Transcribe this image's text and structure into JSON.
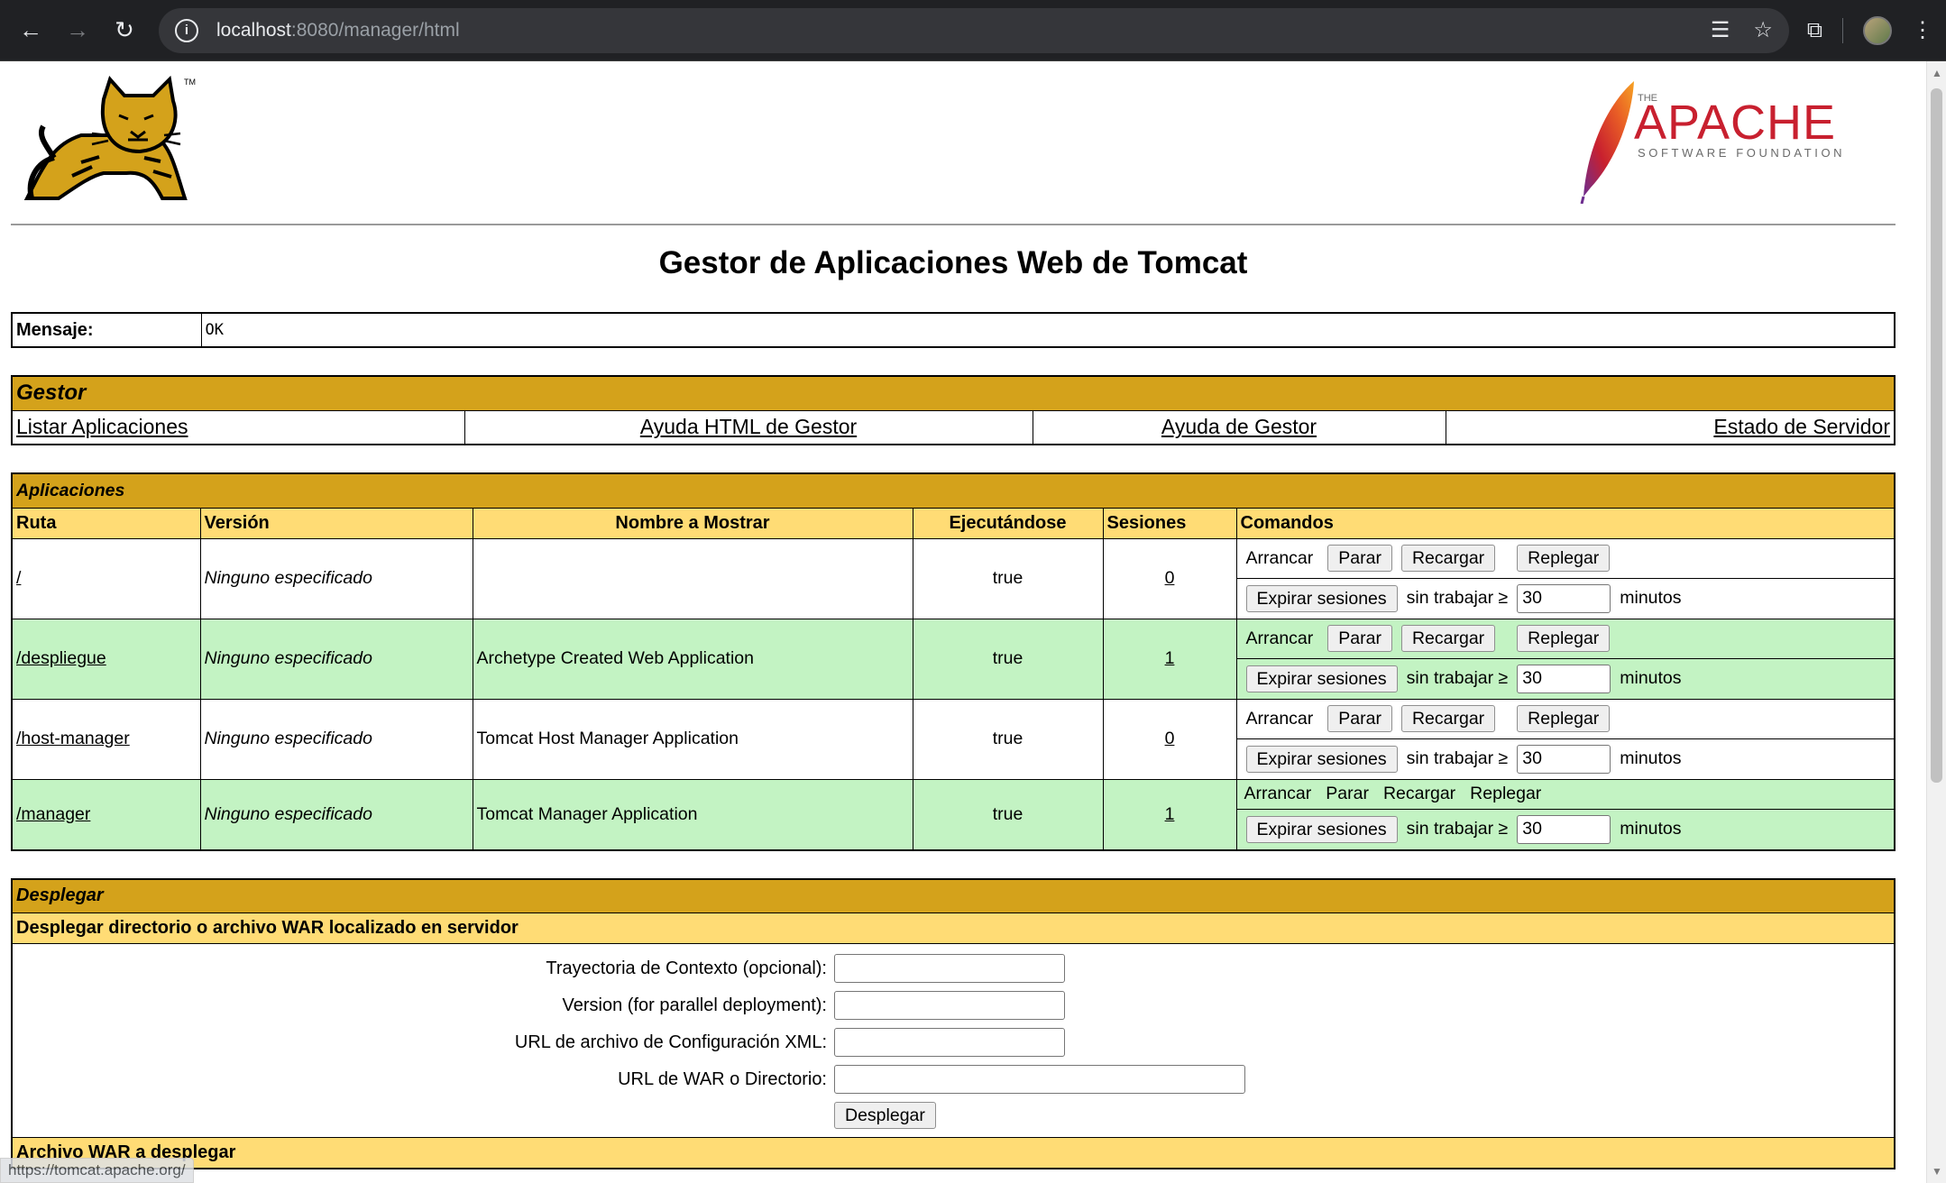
{
  "browser": {
    "url_host": "localhost",
    "url_rest": ":8080/manager/html",
    "icons": [
      "back-icon",
      "forward-icon",
      "reload-icon",
      "site-info-icon",
      "translate-icon",
      "star-icon",
      "extensions-icon",
      "avatar",
      "menu-icon"
    ]
  },
  "header": {
    "title": "Gestor de Aplicaciones Web de Tomcat",
    "apache_the": "THE",
    "apache_name": "APACHE",
    "apache_sub": "SOFTWARE FOUNDATION",
    "tomcat_tm": "TM"
  },
  "message": {
    "label": "Mensaje:",
    "value": "OK"
  },
  "manager": {
    "title": "Gestor",
    "links": [
      "Listar Aplicaciones",
      "Ayuda HTML de Gestor",
      "Ayuda de Gestor",
      "Estado de Servidor"
    ]
  },
  "applications": {
    "title": "Aplicaciones",
    "columns": [
      "Ruta",
      "Versión",
      "Nombre a Mostrar",
      "Ejecutándose",
      "Sesiones",
      "Comandos"
    ],
    "rows": [
      {
        "path": "/",
        "version": "Ninguno especificado",
        "display": "",
        "running": "true",
        "sessions": "0"
      },
      {
        "path": "/despliegue",
        "version": "Ninguno especificado",
        "display": "Archetype Created Web Application",
        "running": "true",
        "sessions": "1"
      },
      {
        "path": "/host-manager",
        "version": "Ninguno especificado",
        "display": "Tomcat Host Manager Application",
        "running": "true",
        "sessions": "0"
      },
      {
        "path": "/manager",
        "version": "Ninguno especificado",
        "display": "Tomcat Manager Application",
        "running": "true",
        "sessions": "1"
      }
    ],
    "commands": {
      "start": "Arrancar",
      "stop": "Parar",
      "reload": "Recargar",
      "undeploy": "Replegar",
      "expire": "Expirar sesiones",
      "idle": "sin trabajar ≥",
      "idle_value": "30",
      "minutes": "minutos"
    }
  },
  "deploy": {
    "title": "Desplegar",
    "server_sub": "Desplegar directorio o archivo WAR localizado en servidor",
    "fields": {
      "context": "Trayectoria de Contexto (opcional):",
      "version": "Version (for parallel deployment):",
      "config": "URL de archivo de Configuración XML:",
      "war": "URL de WAR o Directorio:"
    },
    "button": "Desplegar",
    "war_sub": "Archivo WAR a desplegar"
  },
  "status_bar": "https://tomcat.apache.org/"
}
